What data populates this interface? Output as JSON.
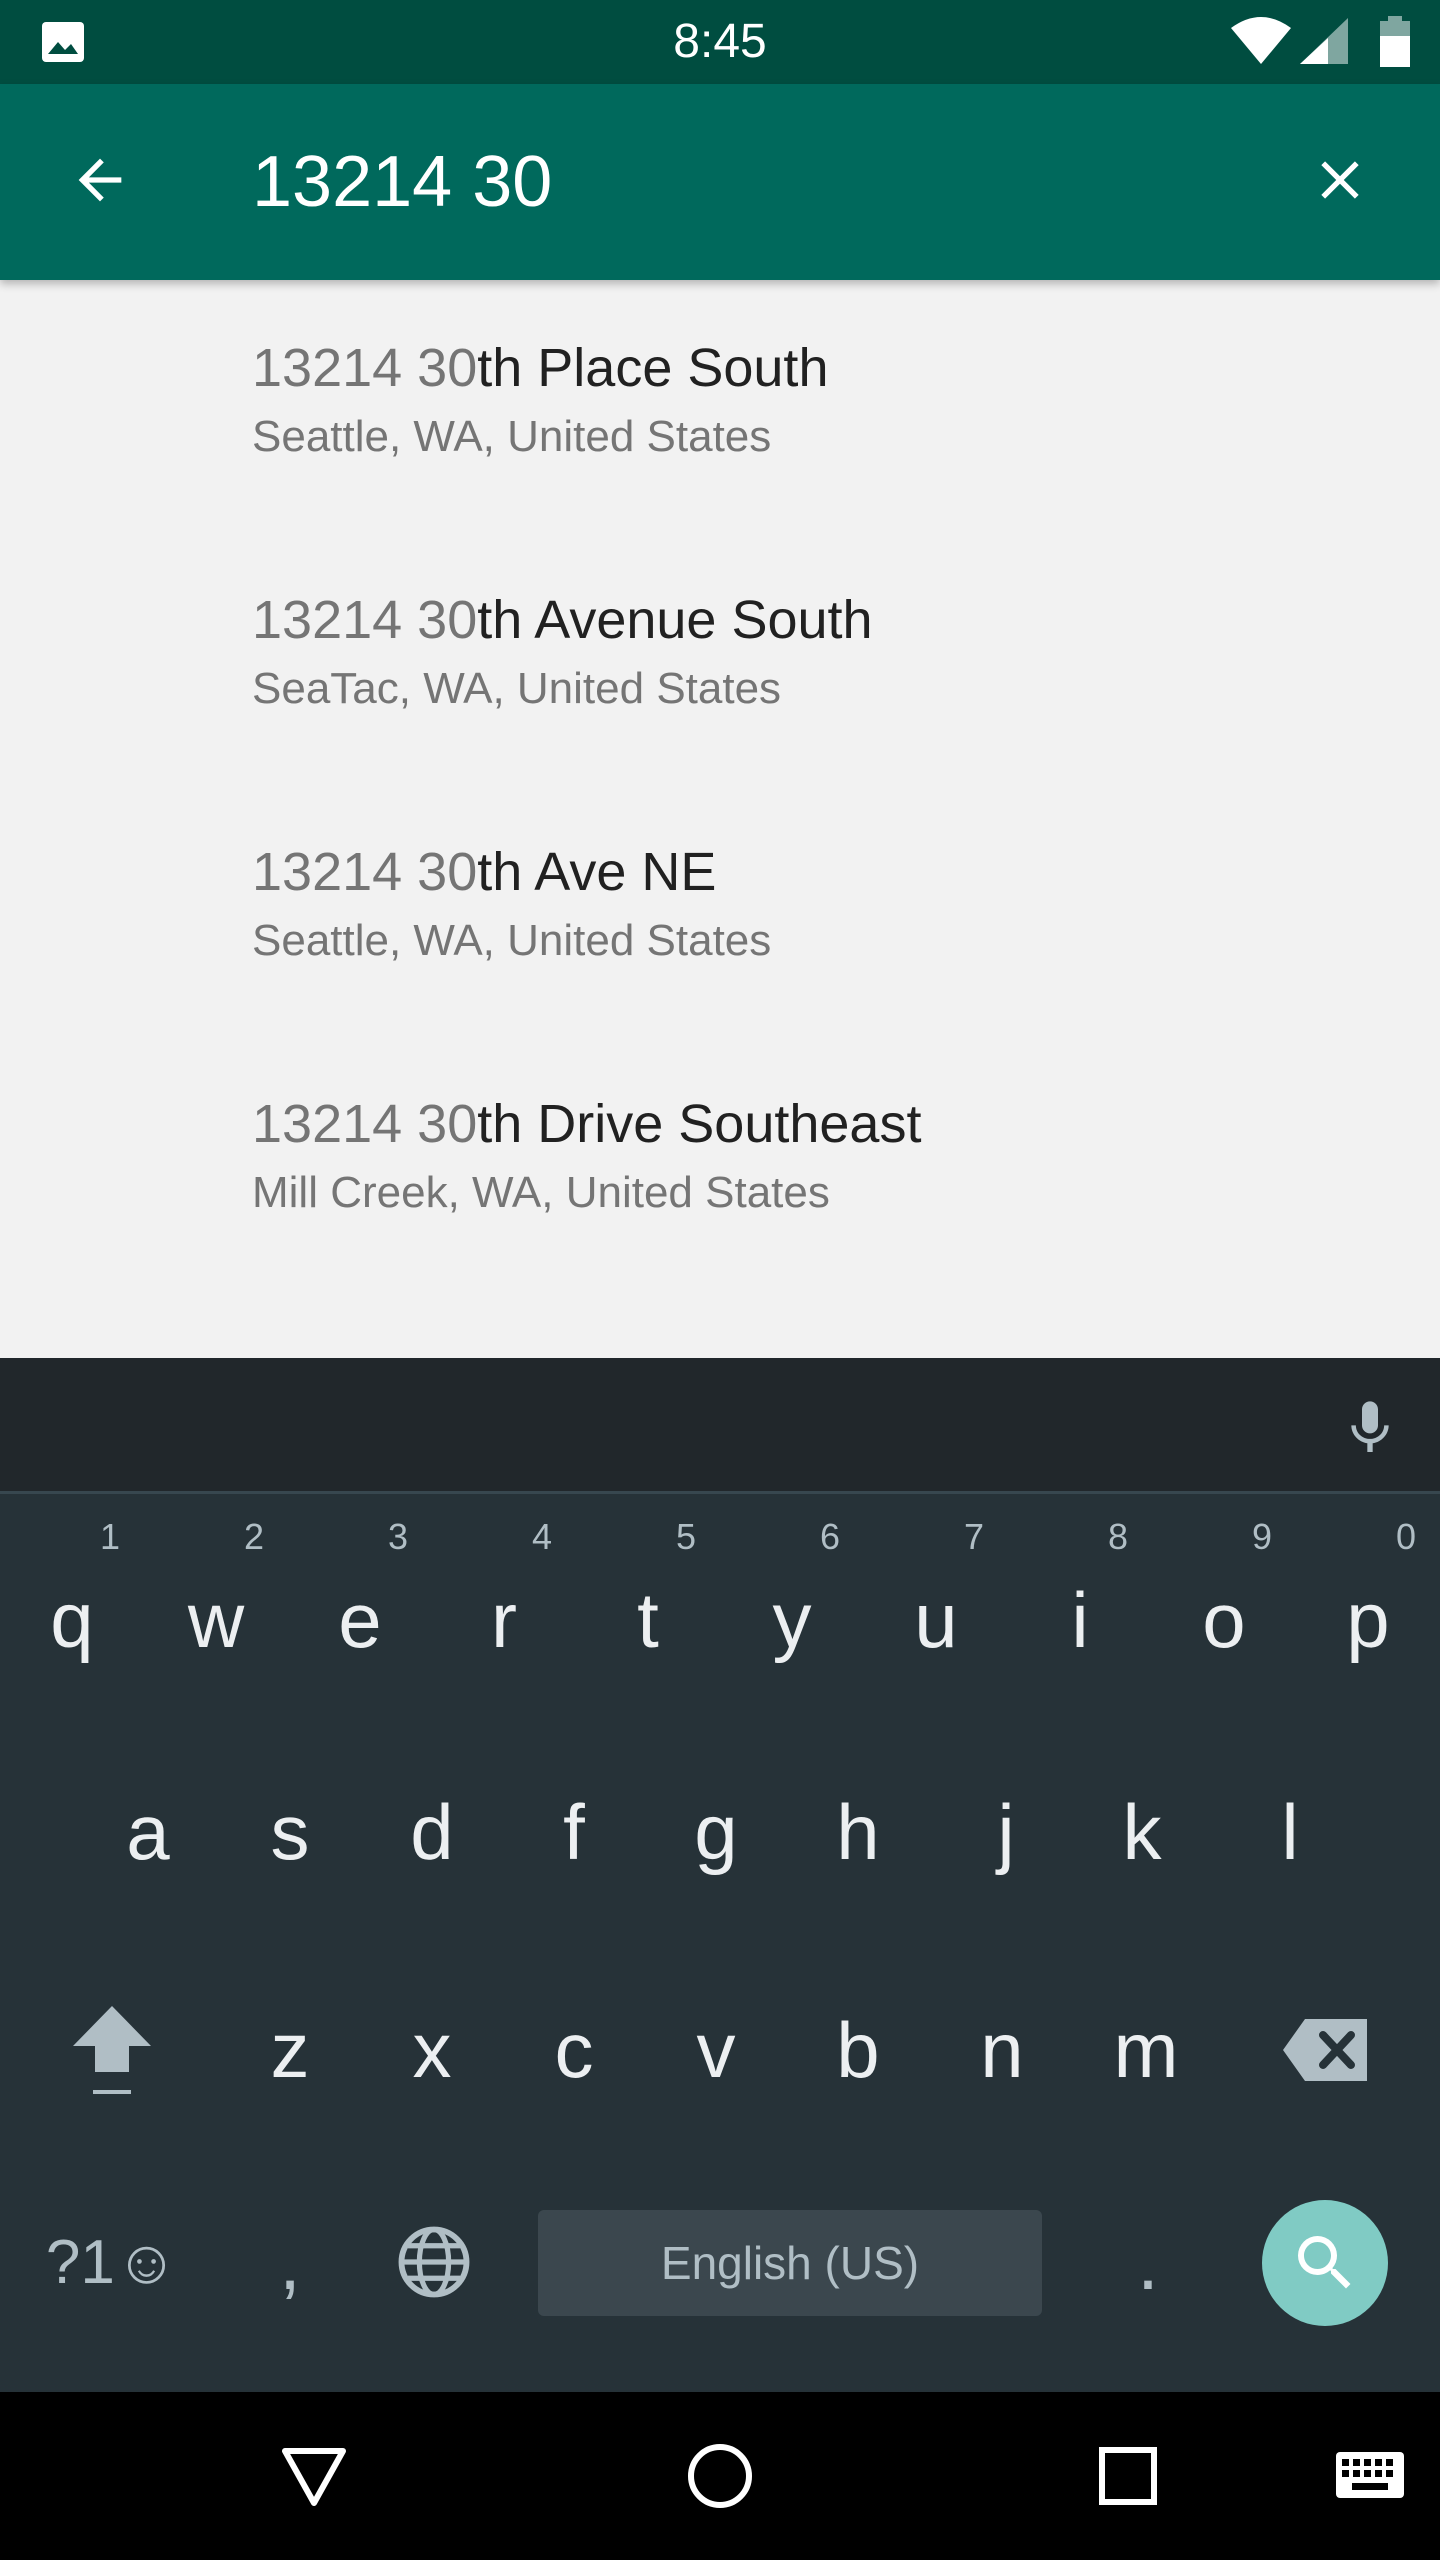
{
  "status_bar": {
    "time": "8:45"
  },
  "app_bar": {
    "search_value": "13214 30"
  },
  "suggestions": [
    {
      "match": "13214 30",
      "rest": "th Place South",
      "subtitle": "Seattle, WA, United States"
    },
    {
      "match": "13214 30",
      "rest": "th Avenue South",
      "subtitle": "SeaTac, WA, United States"
    },
    {
      "match": "13214 30",
      "rest": "th Ave NE",
      "subtitle": "Seattle, WA, United States"
    },
    {
      "match": "13214 30",
      "rest": "th Drive Southeast",
      "subtitle": "Mill Creek, WA, United States"
    }
  ],
  "keyboard": {
    "row1": [
      {
        "ch": "q",
        "num": "1"
      },
      {
        "ch": "w",
        "num": "2"
      },
      {
        "ch": "e",
        "num": "3"
      },
      {
        "ch": "r",
        "num": "4"
      },
      {
        "ch": "t",
        "num": "5"
      },
      {
        "ch": "y",
        "num": "6"
      },
      {
        "ch": "u",
        "num": "7"
      },
      {
        "ch": "i",
        "num": "8"
      },
      {
        "ch": "o",
        "num": "9"
      },
      {
        "ch": "p",
        "num": "0"
      }
    ],
    "row2": [
      "a",
      "s",
      "d",
      "f",
      "g",
      "h",
      "j",
      "k",
      "l"
    ],
    "row3": [
      "z",
      "x",
      "c",
      "v",
      "b",
      "n",
      "m"
    ],
    "symbols_label": "?1☺",
    "comma": ",",
    "period": ".",
    "space_label": "English (US)"
  },
  "colors": {
    "status_bar": "#004d40",
    "app_bar": "#00695c",
    "keyboard_bg": "#263238",
    "search_key": "#80cbc4"
  }
}
